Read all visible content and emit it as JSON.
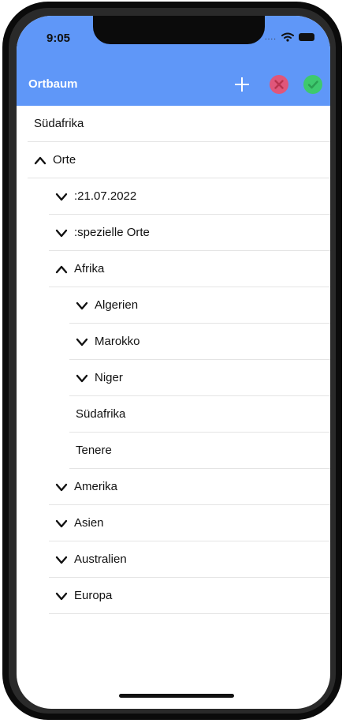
{
  "status_bar": {
    "time": "9:05",
    "signal_dots": "....",
    "icons": [
      "wifi-icon",
      "battery-icon"
    ]
  },
  "nav": {
    "title": "Ortbaum",
    "buttons": [
      {
        "name": "add",
        "icon": "plus-icon",
        "color": "#ffffff"
      },
      {
        "name": "cancel",
        "icon": "x-circle-icon",
        "color": "#e0567a"
      },
      {
        "name": "confirm",
        "icon": "check-circle-icon",
        "color": "#3ec96e"
      }
    ],
    "bar_color": "#5f97f8"
  },
  "tree": {
    "items": [
      {
        "label": "Südafrika",
        "level": 0,
        "expander": "none"
      },
      {
        "label": "Orte",
        "level": 0,
        "expander": "expanded"
      },
      {
        "label": ":21.07.2022",
        "level": 1,
        "expander": "collapsed"
      },
      {
        "label": ":spezielle Orte",
        "level": 1,
        "expander": "collapsed"
      },
      {
        "label": "Afrika",
        "level": 1,
        "expander": "expanded"
      },
      {
        "label": "Algerien",
        "level": 2,
        "expander": "collapsed"
      },
      {
        "label": "Marokko",
        "level": 2,
        "expander": "collapsed"
      },
      {
        "label": "Niger",
        "level": 2,
        "expander": "collapsed"
      },
      {
        "label": "Südafrika",
        "level": 2,
        "expander": "none"
      },
      {
        "label": "Tenere",
        "level": 2,
        "expander": "none"
      },
      {
        "label": "Amerika",
        "level": 1,
        "expander": "collapsed"
      },
      {
        "label": "Asien",
        "level": 1,
        "expander": "collapsed"
      },
      {
        "label": "Australien",
        "level": 1,
        "expander": "collapsed"
      },
      {
        "label": "Europa",
        "level": 1,
        "expander": "collapsed"
      }
    ]
  }
}
